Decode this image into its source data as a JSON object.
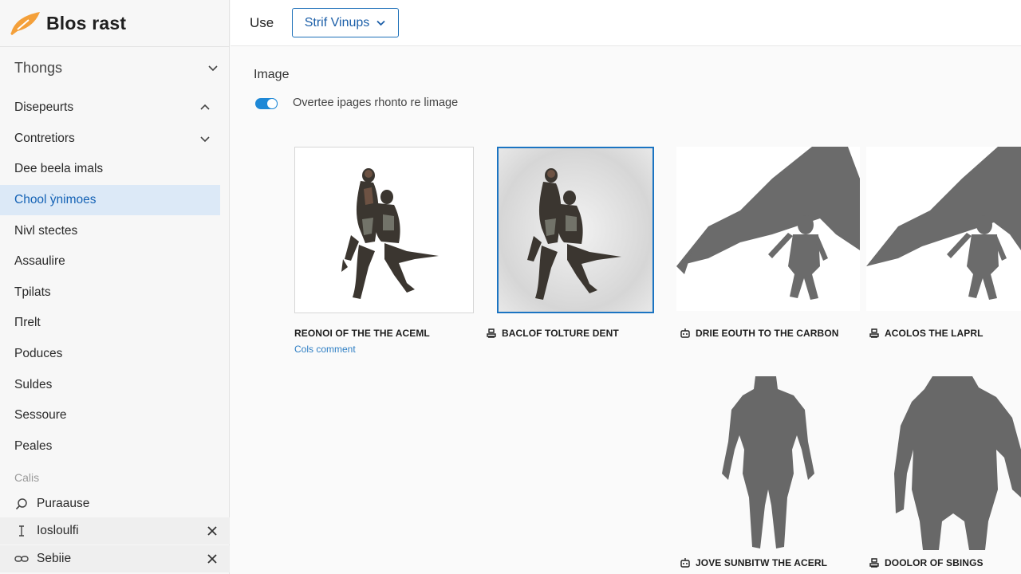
{
  "brand": {
    "name": "Blos rast",
    "logo_icon": "feather-logo-icon",
    "accent": "#f4a03a"
  },
  "sidebar": {
    "group_head": "Thongs",
    "items": [
      {
        "label": "Disepeurts",
        "chevron": "up"
      },
      {
        "label": "Contretiors",
        "chevron": "down"
      },
      {
        "label": "Dee beela imals",
        "chevron": ""
      },
      {
        "label": "Chool ỳnimoes",
        "chevron": ""
      },
      {
        "label": "Nivl stectes",
        "chevron": ""
      },
      {
        "label": "Assaulire",
        "chevron": ""
      },
      {
        "label": "Tpilats",
        "chevron": ""
      },
      {
        "label": "Πrelt",
        "chevron": ""
      },
      {
        "label": "Poduces",
        "chevron": ""
      },
      {
        "label": "Suldes",
        "chevron": ""
      },
      {
        "label": "Sessoure",
        "chevron": ""
      },
      {
        "label": "Peales",
        "chevron": ""
      }
    ],
    "active_index": 3,
    "section_label": "Calis",
    "tools": [
      {
        "label": "Puraause",
        "icon": "search-icon",
        "closable": false
      },
      {
        "label": "Iosloulfi",
        "icon": "text-cursor-icon",
        "closable": true
      },
      {
        "label": "Sebiie",
        "icon": "link-icon",
        "closable": true
      }
    ]
  },
  "topbar": {
    "use_label": "Use",
    "select_value": "Strif Vinups"
  },
  "main": {
    "title": "Image",
    "toggle": {
      "on": true,
      "label": "Overtee ipages rhonto re limage"
    },
    "cards": [
      {
        "caption": "REONOI OF THE THE ACEML",
        "icon": "",
        "sublink": "Cols comment",
        "figure": "warriors-figure",
        "style": "bordered"
      },
      {
        "caption": "BACLOF TOLTURE DENT",
        "icon": "stamp-icon",
        "sublink": "",
        "figure": "warriors-figure",
        "style": "selected"
      },
      {
        "caption": "DRIE EOUTH TO THE CARBON",
        "icon": "robot-icon",
        "sublink": "",
        "figure": "winged-silhouette",
        "style": "plain"
      },
      {
        "caption": "ACOLOS THE LAPRL",
        "icon": "stamp-icon",
        "sublink": "",
        "figure": "winged-silhouette",
        "style": "plain"
      },
      {
        "caption": "JOVE SUNBITW THE ACERL",
        "icon": "robot-icon",
        "sublink": "",
        "figure": "humanoid-silhouette",
        "style": "plain"
      },
      {
        "caption": "DOOLOR OF SBINGS",
        "icon": "stamp-icon",
        "sublink": "",
        "figure": "humanoid-silhouette",
        "style": "plain"
      }
    ]
  }
}
